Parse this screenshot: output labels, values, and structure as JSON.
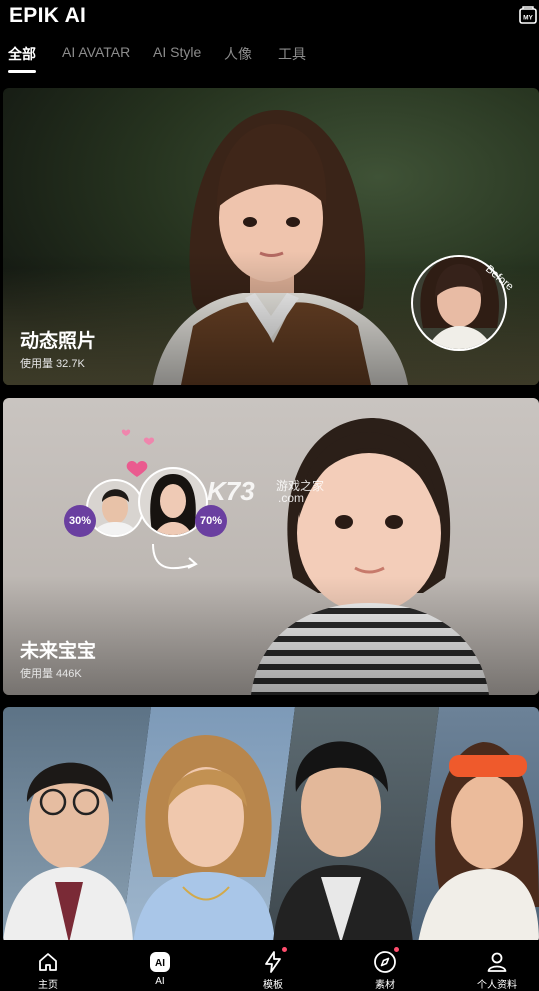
{
  "header": {
    "title": "EPIK AI",
    "my_icon_label": "MY"
  },
  "tabs": [
    {
      "label": "全部",
      "active": true
    },
    {
      "label": "AI AVATAR",
      "active": false
    },
    {
      "label": "AI Style",
      "active": false
    },
    {
      "label": "人像",
      "active": false
    },
    {
      "label": "工具",
      "active": false
    }
  ],
  "cards": [
    {
      "title": "动态照片",
      "usage": "使用量 32.7K",
      "before_label": "Before"
    },
    {
      "title": "未来宝宝",
      "usage": "使用量 446K",
      "ratio_left": "30%",
      "ratio_right": "70%"
    },
    {
      "title": "",
      "usage": ""
    }
  ],
  "watermark": {
    "brand": "K73",
    "cn": "游戏之家",
    "dotcom": ".com"
  },
  "bottom_nav": [
    {
      "label": "主页",
      "icon": "home-icon",
      "dot": false
    },
    {
      "label": "AI",
      "icon": "ai-icon",
      "dot": false
    },
    {
      "label": "模板",
      "icon": "lightning-icon",
      "dot": true
    },
    {
      "label": "素材",
      "icon": "compass-icon",
      "dot": true
    },
    {
      "label": "个人资料",
      "icon": "profile-icon",
      "dot": false
    }
  ],
  "colors": {
    "accent": "#6a3fa0",
    "notification_dot": "#ff4d6d",
    "background": "#000000"
  }
}
